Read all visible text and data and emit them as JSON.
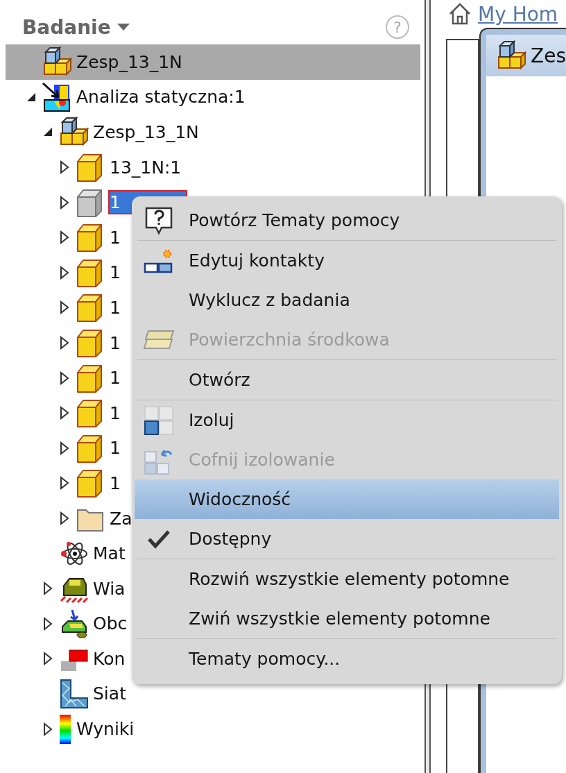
{
  "browser": {
    "title": "Badanie",
    "help_button": "?",
    "tree": [
      {
        "label": "Zesp_13_1N",
        "kind": "assembly",
        "selected": true,
        "editing": false
      },
      {
        "label": "Analiza statyczna:1",
        "kind": "analysis",
        "expanded": true,
        "selected": false,
        "editing": false,
        "children": [
          {
            "label": "Zesp_13_1N",
            "kind": "assembly",
            "expanded": true,
            "selected": false,
            "editing": false,
            "children": [
              {
                "label": "13_1N:1",
                "kind": "part",
                "expanded": false,
                "selected": false,
                "editing": false
              },
              {
                "label": "1",
                "kind": "part-suppressed",
                "expanded": false,
                "selected": false,
                "editing": true
              },
              {
                "label": "1",
                "kind": "part",
                "expanded": false,
                "selected": false,
                "editing": false
              },
              {
                "label": "1",
                "kind": "part",
                "expanded": false,
                "selected": false,
                "editing": false
              },
              {
                "label": "1",
                "kind": "part",
                "expanded": false,
                "selected": false,
                "editing": false
              },
              {
                "label": "1",
                "kind": "part",
                "expanded": false,
                "selected": false,
                "editing": false
              },
              {
                "label": "1",
                "kind": "part",
                "expanded": false,
                "selected": false,
                "editing": false
              },
              {
                "label": "1",
                "kind": "part",
                "expanded": false,
                "selected": false,
                "editing": false
              },
              {
                "label": "1",
                "kind": "part",
                "expanded": false,
                "selected": false,
                "editing": false
              },
              {
                "label": "1",
                "kind": "part",
                "expanded": false,
                "selected": false,
                "editing": false
              },
              {
                "label": "Za",
                "kind": "folder",
                "expanded": false,
                "selected": false,
                "editing": false
              }
            ]
          },
          {
            "label": "Mat",
            "kind": "material",
            "selected": false,
            "editing": false
          },
          {
            "label": "Wia",
            "kind": "constraint",
            "expanded": false,
            "selected": false,
            "editing": false
          },
          {
            "label": "Obc",
            "kind": "load",
            "expanded": false,
            "selected": false,
            "editing": false
          },
          {
            "label": "Kon",
            "kind": "contact",
            "expanded": false,
            "selected": false,
            "editing": false
          },
          {
            "label": "Siat",
            "kind": "mesh",
            "selected": false,
            "editing": false
          },
          {
            "label": "Wyniki",
            "kind": "results",
            "expanded": false,
            "selected": false,
            "editing": false
          }
        ]
      }
    ]
  },
  "document_area": {
    "home_tab": "My Hom",
    "window_title": "Zes"
  },
  "context_menu": [
    {
      "kind": "help",
      "label": "Powtórz Tematy pomocy",
      "disabled": false,
      "checked": false,
      "selected": false
    },
    {
      "kind": "separator"
    },
    {
      "kind": "contacts",
      "label": "Edytuj kontakty",
      "disabled": false,
      "checked": false,
      "selected": false
    },
    {
      "kind": "plain",
      "label": "Wyklucz z badania",
      "disabled": false,
      "checked": false,
      "selected": false
    },
    {
      "kind": "midsurface",
      "label": "Powierzchnia środkowa",
      "disabled": true,
      "checked": false,
      "selected": false
    },
    {
      "kind": "separator"
    },
    {
      "kind": "plain",
      "label": "Otwórz",
      "disabled": false,
      "checked": false,
      "selected": false
    },
    {
      "kind": "separator"
    },
    {
      "kind": "isolate",
      "label": "Izoluj",
      "disabled": false,
      "checked": false,
      "selected": false
    },
    {
      "kind": "undo-isolate",
      "label": "Cofnij izolowanie",
      "disabled": true,
      "checked": false,
      "selected": false
    },
    {
      "kind": "plain",
      "label": "Widoczność",
      "disabled": false,
      "checked": false,
      "selected": true
    },
    {
      "kind": "plain",
      "label": "Dostępny",
      "disabled": false,
      "checked": true,
      "selected": false
    },
    {
      "kind": "separator"
    },
    {
      "kind": "plain",
      "label": "Rozwiń wszystkie elementy potomne",
      "disabled": false,
      "checked": false,
      "selected": false
    },
    {
      "kind": "plain",
      "label": "Zwiń wszystkie elementy potomne",
      "disabled": false,
      "checked": false,
      "selected": false
    },
    {
      "kind": "separator"
    },
    {
      "kind": "plain",
      "label": "Tematy pomocy...",
      "disabled": false,
      "checked": false,
      "selected": false
    }
  ]
}
